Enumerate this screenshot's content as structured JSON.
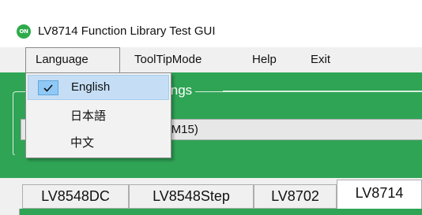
{
  "window": {
    "title": "LV8714 Function Library Test GUI",
    "logo_text": "ON",
    "accent_color": "#2fa455"
  },
  "menubar": {
    "items": [
      {
        "label": "Language"
      },
      {
        "label": "ToolTipMode"
      },
      {
        "label": "Help"
      },
      {
        "label": "Exit"
      }
    ]
  },
  "language_menu": {
    "items": [
      {
        "label": "English",
        "checked": true
      },
      {
        "label": "日本語",
        "checked": false
      },
      {
        "label": "中文",
        "checked": false
      }
    ]
  },
  "settings_group": {
    "title_fragment": "ings",
    "port_value_fragment": "OM15)"
  },
  "tabs": [
    {
      "label": "LV8548DC",
      "active": false
    },
    {
      "label": "LV8548Step",
      "active": false
    },
    {
      "label": "LV8702",
      "active": false
    },
    {
      "label": "LV8714",
      "active": true
    }
  ]
}
